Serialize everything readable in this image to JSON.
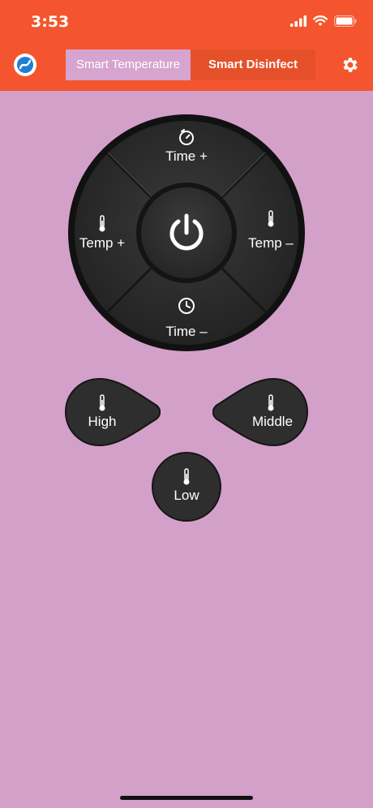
{
  "status_bar": {
    "time": "3:53"
  },
  "tabs": [
    {
      "label": "Smart Temperature",
      "selected": true
    },
    {
      "label": "Smart Disinfect",
      "selected": false
    }
  ],
  "colors": {
    "header": "#f4552e",
    "background": "#d3a0c9",
    "tab_selected": "#d7a4d0",
    "button": "#2e2e2e"
  },
  "dpad": {
    "top_label": "Time +",
    "bottom_label": "Time –",
    "left_label": "Temp +",
    "right_label": "Temp –"
  },
  "modes": {
    "high_label": "High",
    "middle_label": "Middle",
    "low_label": "Low"
  }
}
